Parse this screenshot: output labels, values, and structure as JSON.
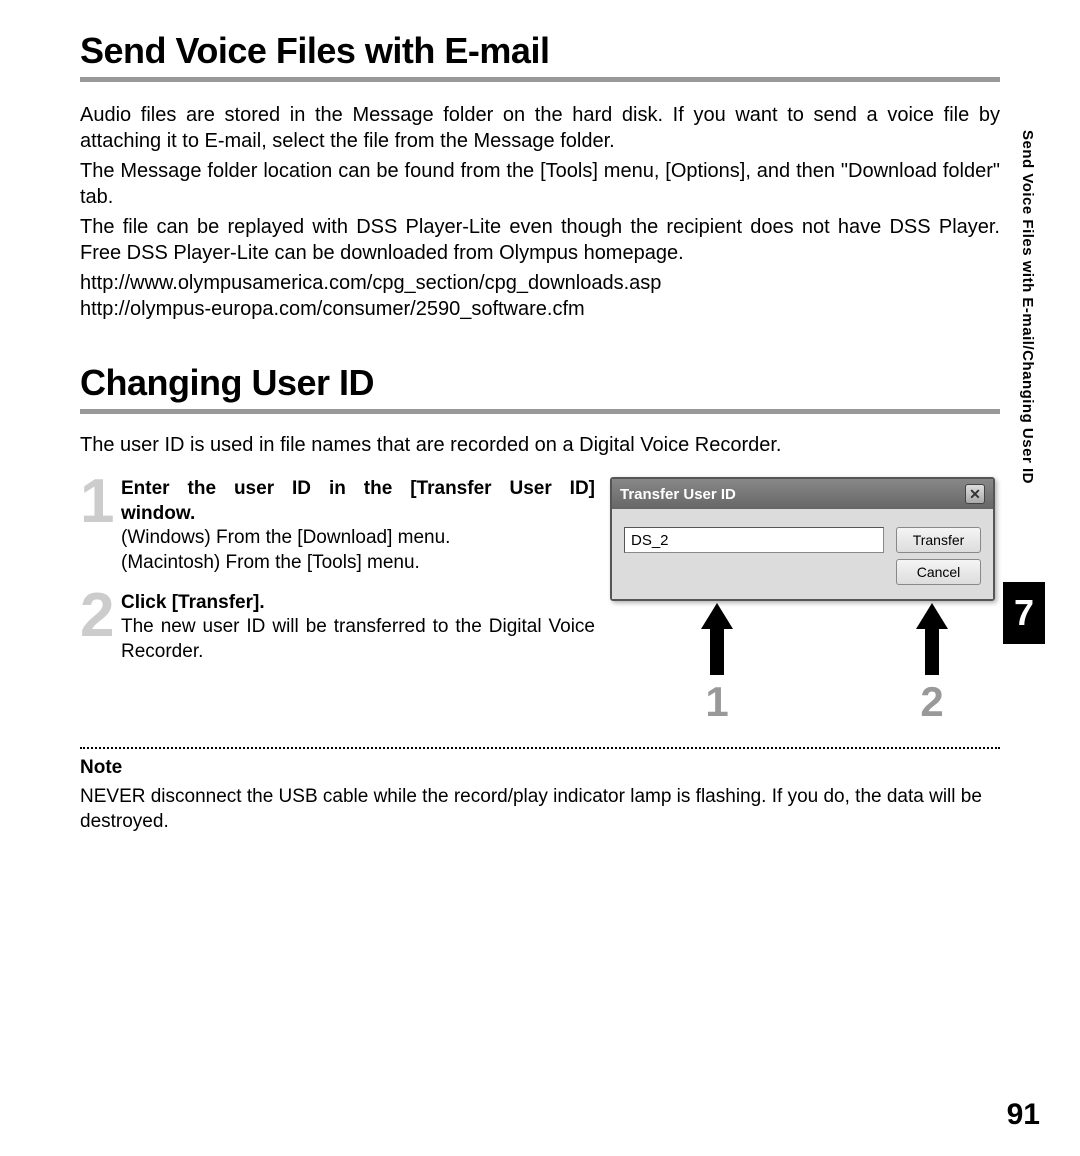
{
  "sidebar_text": "Send Voice Files with E-mail/Changing User ID",
  "chapter_number": "7",
  "page_number": "91",
  "section1": {
    "heading": "Send Voice Files with E-mail",
    "para1": "Audio files are stored in the Message folder on the hard disk. If you want to send a voice file by attaching it to E-mail, select the file from the Message folder.",
    "para2": "The Message folder location can be found from the [Tools] menu, [Options], and then \"Download folder\" tab.",
    "para3": "The file can be replayed with DSS Player-Lite even though the recipient does not have DSS Player. Free DSS Player-Lite can be downloaded from Olympus homepage.",
    "url1": "http://www.olympusamerica.com/cpg_section/cpg_downloads.asp",
    "url2": "http://olympus-europa.com/consumer/2590_software.cfm"
  },
  "section2": {
    "heading": "Changing User ID",
    "intro": "The user ID is used in file names that are recorded on a Digital Voice Recorder.",
    "step1": {
      "num": "1",
      "title": "Enter the user ID in the [Transfer User ID] window.",
      "desc1": "(Windows) From the [Download] menu.",
      "desc2": "(Macintosh) From the [Tools] menu."
    },
    "step2": {
      "num": "2",
      "title": "Click [Transfer].",
      "desc": "The new user ID will be transferred to the Digital Voice Recorder."
    }
  },
  "dialog": {
    "title": "Transfer User ID",
    "close": "✕",
    "input_value": "DS_2",
    "transfer_btn": "Transfer",
    "cancel_btn": "Cancel"
  },
  "arrows": {
    "label1": "1",
    "label2": "2"
  },
  "note": {
    "label": "Note",
    "text": "NEVER disconnect the USB cable while the record/play indicator lamp is flashing. If you do, the data will be destroyed."
  }
}
